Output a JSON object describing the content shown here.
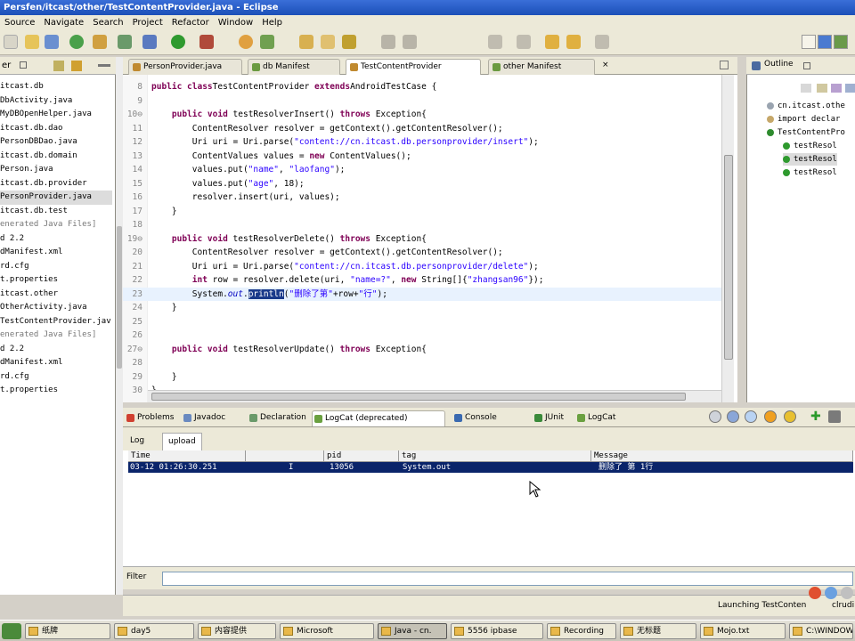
{
  "window": {
    "title": "Persfen/itcast/other/TestContentProvider.java - Eclipse"
  },
  "menu": [
    "Source",
    "Navigate",
    "Search",
    "Project",
    "Refactor",
    "Window",
    "Help"
  ],
  "left": {
    "tree": [
      {
        "text": "itcast.db"
      },
      {
        "text": "DbActivity.java"
      },
      {
        "text": "MyDBOpenHelper.java"
      },
      {
        "text": "itcast.db.dao"
      },
      {
        "text": "PersonDBDao.java"
      },
      {
        "text": "itcast.db.domain"
      },
      {
        "text": "Person.java"
      },
      {
        "text": "itcast.db.provider"
      },
      {
        "text": "PersonProvider.java",
        "hl": true
      },
      {
        "text": "itcast.db.test"
      },
      {
        "text": "enerated Java Files]",
        "gen": true
      },
      {
        "text": "d 2.2"
      },
      {
        "text": ""
      },
      {
        "text": ""
      },
      {
        "text": ""
      },
      {
        "text": "dManifest.xml"
      },
      {
        "text": "rd.cfg"
      },
      {
        "text": "t.properties"
      },
      {
        "text": ""
      },
      {
        "text": ""
      },
      {
        "text": "itcast.other"
      },
      {
        "text": "OtherActivity.java"
      },
      {
        "text": "TestContentProvider.jav"
      },
      {
        "text": "enerated Java Files]",
        "gen": true
      },
      {
        "text": "d 2.2"
      },
      {
        "text": ""
      },
      {
        "text": ""
      },
      {
        "text": "dManifest.xml"
      },
      {
        "text": "rd.cfg"
      },
      {
        "text": "t.properties"
      }
    ]
  },
  "editor": {
    "tabs": [
      {
        "label": "PersonProvider.java",
        "active": false
      },
      {
        "label": "db Manifest",
        "active": false
      },
      {
        "label": "TestContentProvider",
        "active": true
      },
      {
        "label": "other Manifest",
        "active": false
      }
    ],
    "lines": [
      {
        "n": "8",
        "code": [
          [
            "kw",
            "public class"
          ],
          [
            "",
            "TestContentProvider "
          ],
          [
            "kw",
            "extends"
          ],
          [
            "",
            "AndroidTestCase {"
          ]
        ]
      },
      {
        "n": "9",
        "code": []
      },
      {
        "n": "10⊖",
        "code": [
          [
            "",
            "    "
          ],
          [
            "kw",
            "public void"
          ],
          [
            "",
            " testResolverInsert() "
          ],
          [
            "kw",
            "throws"
          ],
          [
            "",
            " Exception{"
          ]
        ]
      },
      {
        "n": "11",
        "code": [
          [
            "",
            "        ContentResolver resolver = getContext().getContentResolver();"
          ]
        ]
      },
      {
        "n": "12",
        "code": [
          [
            "",
            "        Uri uri = Uri.parse("
          ],
          [
            "str",
            "\"content://cn.itcast.db.personprovider/insert\""
          ],
          [
            "",
            ");"
          ]
        ]
      },
      {
        "n": "13",
        "code": [
          [
            "",
            "        ContentValues values = "
          ],
          [
            "kw",
            "new"
          ],
          [
            "",
            " ContentValues();"
          ]
        ]
      },
      {
        "n": "14",
        "code": [
          [
            "",
            "        values.put("
          ],
          [
            "str",
            "\"name\""
          ],
          [
            "",
            ", "
          ],
          [
            "str",
            "\"laofang\""
          ],
          [
            "",
            ");"
          ]
        ]
      },
      {
        "n": "15",
        "code": [
          [
            "",
            "        values.put("
          ],
          [
            "str",
            "\"age\""
          ],
          [
            "",
            ", 18);"
          ]
        ]
      },
      {
        "n": "16",
        "code": [
          [
            "",
            "        resolver.insert(uri, values);"
          ]
        ]
      },
      {
        "n": "17",
        "code": [
          [
            "",
            "    }"
          ]
        ]
      },
      {
        "n": "18",
        "code": []
      },
      {
        "n": "19⊖",
        "code": [
          [
            "",
            "    "
          ],
          [
            "kw",
            "public void"
          ],
          [
            "",
            " testResolverDelete() "
          ],
          [
            "kw",
            "throws"
          ],
          [
            "",
            " Exception{"
          ]
        ]
      },
      {
        "n": "20",
        "code": [
          [
            "",
            "        ContentResolver resolver = getContext().getContentResolver();"
          ]
        ]
      },
      {
        "n": "21",
        "code": [
          [
            "",
            "        Uri uri = Uri.parse("
          ],
          [
            "str",
            "\"content://cn.itcast.db.personprovider/delete\""
          ],
          [
            "",
            ");"
          ]
        ]
      },
      {
        "n": "22",
        "code": [
          [
            "",
            "        "
          ],
          [
            "kw",
            "int"
          ],
          [
            "",
            " row = resolver.delete(uri, "
          ],
          [
            "str",
            "\"name=?\""
          ],
          [
            "",
            ", "
          ],
          [
            "kw",
            "new"
          ],
          [
            "",
            " String[]{"
          ],
          [
            "str",
            "\"zhangsan96\""
          ],
          [
            "",
            "});"
          ]
        ]
      },
      {
        "n": "23",
        "cur": true,
        "code": [
          [
            "",
            "        System."
          ],
          [
            "fld",
            "out"
          ],
          [
            "",
            "."
          ],
          [
            "sel",
            "println"
          ],
          [
            "",
            "("
          ],
          [
            "str",
            "\"删除了第\""
          ],
          [
            "",
            "+row+"
          ],
          [
            "str",
            "\"行\""
          ],
          [
            "",
            ");"
          ]
        ]
      },
      {
        "n": "24",
        "code": [
          [
            "",
            "    }"
          ]
        ]
      },
      {
        "n": "25",
        "code": []
      },
      {
        "n": "26",
        "code": []
      },
      {
        "n": "27⊖",
        "code": [
          [
            "",
            "    "
          ],
          [
            "kw",
            "public void"
          ],
          [
            "",
            " testResolverUpdate() "
          ],
          [
            "kw",
            "throws"
          ],
          [
            "",
            " Exception{"
          ]
        ]
      },
      {
        "n": "28",
        "code": []
      },
      {
        "n": "29",
        "code": [
          [
            "",
            "    }"
          ]
        ]
      },
      {
        "n": "30",
        "code": [
          [
            "",
            "}"
          ]
        ]
      }
    ]
  },
  "outline": {
    "tab": "Outline",
    "items": [
      {
        "text": "cn.itcast.othe",
        "indent": 22,
        "dot": "#9aa4b0"
      },
      {
        "text": "import declar",
        "indent": 22,
        "dot": "#c6a86a"
      },
      {
        "text": "TestContentPro",
        "indent": 22,
        "dot": "#2e8b2e"
      },
      {
        "text": "testResol",
        "indent": 40,
        "dot": "#2e9a2e"
      },
      {
        "text": "testResol",
        "indent": 40,
        "dot": "#2e9a2e",
        "hl": true
      },
      {
        "text": "testResol",
        "indent": 40,
        "dot": "#2e9a2e"
      }
    ]
  },
  "bottom": {
    "tabs": [
      {
        "label": "Problems",
        "active": false
      },
      {
        "label": "Javadoc",
        "active": false
      },
      {
        "label": "Declaration",
        "active": false
      },
      {
        "label": "LogCat (deprecated)",
        "active": true
      },
      {
        "label": "Console",
        "active": false
      },
      {
        "label": "JUnit",
        "active": false
      },
      {
        "label": "LogCat",
        "active": false
      }
    ],
    "subtabs": [
      {
        "label": "Log",
        "active": false
      },
      {
        "label": "upload",
        "active": true
      }
    ],
    "log_columns": [
      "Time",
      "",
      "pid",
      "tag",
      "Message"
    ],
    "log_row": {
      "time": "03-12 01:26:30.251",
      "level": "I",
      "pid": "13056",
      "tag": "System.out",
      "message": "删除了 第 1行"
    },
    "filter_label": "Filter"
  },
  "status": {
    "launching": "Launching TestConten",
    "right": "clrudi"
  },
  "taskbar": [
    {
      "label": "纸牌"
    },
    {
      "label": "day5"
    },
    {
      "label": "内容提供"
    },
    {
      "label": "Microsoft"
    },
    {
      "label": "Java - cn.",
      "active": true
    },
    {
      "label": "5556 ipbase"
    },
    {
      "label": "Recording"
    },
    {
      "label": "无标题"
    },
    {
      "label": "Mojo.txt"
    },
    {
      "label": "C:\\WINDOW"
    }
  ]
}
